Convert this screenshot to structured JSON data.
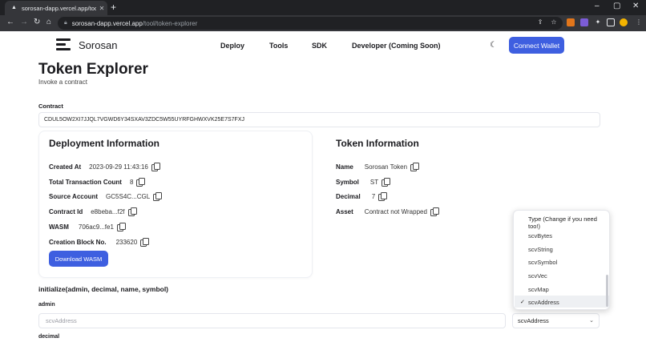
{
  "browser": {
    "tab_title": "sorosan-dapp.vercel.app/tool/to",
    "url_host": "sorosan-dapp.vercel.app",
    "url_path": "/tool/token-explorer"
  },
  "header": {
    "brand": "Sorosan",
    "nav": [
      "Deploy",
      "Tools",
      "SDK",
      "Developer (Coming Soon)"
    ],
    "connect_label": "Connect Wallet",
    "accent": "#3e5fe0"
  },
  "page": {
    "title": "Token Explorer",
    "subtitle": "Invoke a contract",
    "contract_label": "Contract",
    "contract_value": "CDUL5OW2XI7JJQL7VGWD6Y34SXAV3ZDC5W55UYRFGHWXVK25E7S7FXJ"
  },
  "deployment": {
    "title": "Deployment Information",
    "rows": [
      {
        "key": "Created At",
        "value": "2023-09-29 11:43:16"
      },
      {
        "key": "Total Transaction Count",
        "value": "8"
      },
      {
        "key": "Source Account",
        "value": "GC5S4C...CGL"
      },
      {
        "key": "Contract Id",
        "value": "e8beba...f2f"
      },
      {
        "key": "WASM",
        "value": "706ac9...fe1"
      },
      {
        "key": "Creation Block No.",
        "value": "233620"
      }
    ],
    "download_label": "Download WASM"
  },
  "token": {
    "title": "Token Information",
    "rows": [
      {
        "key": "Name",
        "value": "Sorosan Token"
      },
      {
        "key": "Symbol",
        "value": "ST"
      },
      {
        "key": "Decimal",
        "value": "7"
      },
      {
        "key": "Asset",
        "value": "Contract not Wrapped"
      }
    ]
  },
  "invoke": {
    "signature": "initialize(admin, decimal, name, symbol)",
    "arg1_label": "admin",
    "arg1_placeholder": "scvAddress",
    "arg1_type": "scvAddress",
    "arg2_label": "decimal"
  },
  "dropdown": {
    "header": "Type (Change if you need too!)",
    "options": [
      "scvBytes",
      "scvString",
      "scvSymbol",
      "scvVec",
      "scvMap",
      "scvAddress"
    ],
    "selected": "scvAddress"
  }
}
